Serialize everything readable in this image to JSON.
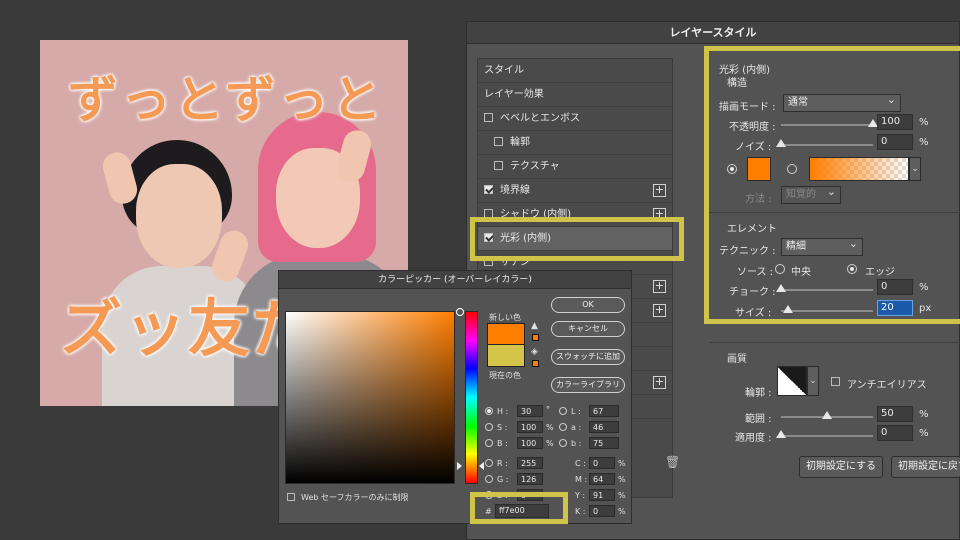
{
  "colors": {
    "accent": "#ff7e00",
    "current": "#d5c44a",
    "highlight": "#cfc34a"
  },
  "photo": {
    "title_line1": "ずっとずっと",
    "title_line2": "ズッ友だ"
  },
  "layer_style": {
    "title": "レイヤースタイル",
    "list": [
      {
        "label": "スタイル",
        "checkbox": false,
        "plus": false
      },
      {
        "label": "レイヤー効果",
        "checkbox": false,
        "plus": false
      },
      {
        "label": "ベベルとエンボス",
        "checkbox": true,
        "checked": false,
        "plus": false
      },
      {
        "label": "輪郭",
        "checkbox": true,
        "checked": false,
        "plus": false,
        "indent": true
      },
      {
        "label": "テクスチャ",
        "checkbox": true,
        "checked": false,
        "plus": false,
        "indent": true
      },
      {
        "label": "境界線",
        "checkbox": true,
        "checked": true,
        "plus": true
      },
      {
        "label": "シャドウ (内側)",
        "checkbox": true,
        "checked": false,
        "plus": true
      },
      {
        "label": "光彩 (内側)",
        "checkbox": true,
        "checked": true,
        "plus": false,
        "selected": true
      },
      {
        "label": "サテン",
        "checkbox": true,
        "checked": false,
        "plus": false
      }
    ],
    "section_title": "光彩 (内側)",
    "structure": {
      "title": "構造",
      "blend_mode_label": "描画モード :",
      "blend_mode_value": "通常",
      "opacity_label": "不透明度 :",
      "opacity_value": "100",
      "opacity_unit": "%",
      "opacity_level": 1.0,
      "noise_label": "ノイズ :",
      "noise_value": "0",
      "noise_unit": "%",
      "noise_level": 0,
      "method_label": "方法 :",
      "method_value": "知覚的"
    },
    "elements": {
      "title": "エレメント",
      "technique_label": "テクニック :",
      "technique_value": "精細",
      "source_label": "ソース :",
      "source_center": "中央",
      "source_edge": "エッジ",
      "choke_label": "チョーク :",
      "choke_value": "0",
      "choke_unit": "%",
      "choke_level": 0,
      "size_label": "サイズ :",
      "size_value": "20",
      "size_unit": "px",
      "size_level": 0.08
    },
    "quality": {
      "title": "画質",
      "contour_label": "輪郭 :",
      "antialias_label": "アンチエイリアス",
      "range_label": "範囲 :",
      "range_value": "50",
      "range_unit": "%",
      "range_level": 0.5,
      "jitter_label": "適用度 :",
      "jitter_value": "0",
      "jitter_unit": "%",
      "jitter_level": 0
    },
    "reset_button": "初期設定にする",
    "reset_default_button": "初期設定に戻す"
  },
  "color_picker": {
    "title": "カラーピッカー (オーバーレイカラー)",
    "new_label": "新しい色",
    "current_label": "現在の色",
    "ok": "OK",
    "cancel": "キャンセル",
    "add_swatch": "スウォッチに追加",
    "libraries": "カラーライブラリ",
    "web_only": "Web セーフカラーのみに制限",
    "H": "30",
    "H_unit": "°",
    "S": "100",
    "S_unit": "%",
    "B": "100",
    "B_unit": "%",
    "R": "255",
    "G": "126",
    "Bv": "0",
    "L": "67",
    "a": "46",
    "b": "75",
    "C": "0",
    "M": "64",
    "Y": "91",
    "K": "0",
    "cmyk_unit": "%",
    "hex_prefix": "#",
    "hex": "ff7e00"
  }
}
